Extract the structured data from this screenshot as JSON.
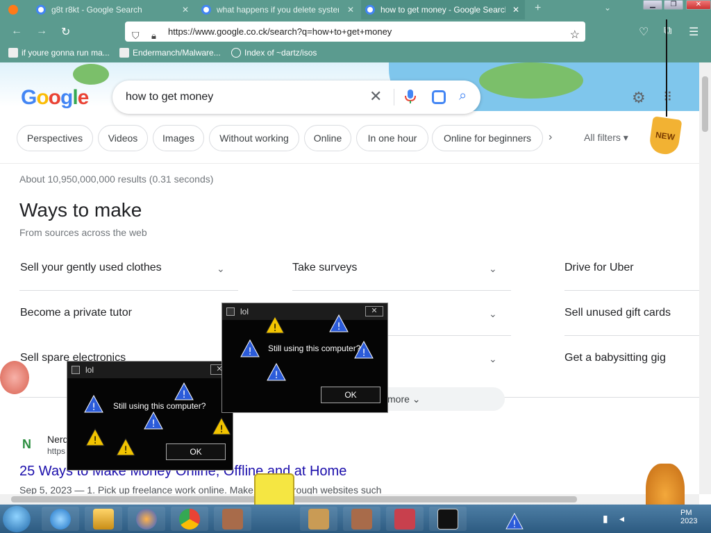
{
  "browser": {
    "tabs": [
      {
        "title": "g8t r8kt - Google Search",
        "active": false
      },
      {
        "title": "what happens if you delete system",
        "active": false
      },
      {
        "title": "how to get money - Google Search",
        "active": true
      }
    ],
    "url": "https://www.google.co.ck/search?q=how+to+get+money",
    "bookmarks": [
      {
        "label": "if youre gonna run ma..."
      },
      {
        "label": "Endermanch/Malware..."
      },
      {
        "label": "Index of ~dartz/isos"
      }
    ]
  },
  "google": {
    "logo": "Google",
    "query": "how to get money",
    "chips": [
      "Perspectives",
      "Videos",
      "Images",
      "Without working",
      "Online",
      "In one hour",
      "Online for beginners"
    ],
    "all_filters": "All filters",
    "new_badge": "NEW",
    "stats": "About 10,950,000,000 results (0.31 seconds)",
    "ways": {
      "title": "Ways to make",
      "subtitle": "From sources across the web",
      "items": [
        "Sell your gently used clothes",
        "Take surveys",
        "Drive for Uber",
        "Become a private tutor",
        "Sell unused gift cards",
        "Sell spare electronics",
        "Get a babysitting gig"
      ],
      "more": "more"
    },
    "result": {
      "site_name": "Nerd",
      "site_url": "https",
      "title": "25 Ways to Make Money Online, Offline and at Home",
      "date": "Sep 5, 2023",
      "snippet": " — 1. Pick up freelance work online. Make   online through websites such"
    }
  },
  "popups": [
    {
      "title": "lol",
      "message": "Still using this computer?",
      "ok": "OK"
    },
    {
      "title": "lol",
      "message": "Still using this computer?",
      "ok": "OK"
    }
  ],
  "taskbar": {
    "clock": "PM\n2023"
  },
  "colors": {
    "browser_chrome": "#5b9b8f",
    "link": "#1a0dab",
    "popup_bg": "#050505"
  }
}
